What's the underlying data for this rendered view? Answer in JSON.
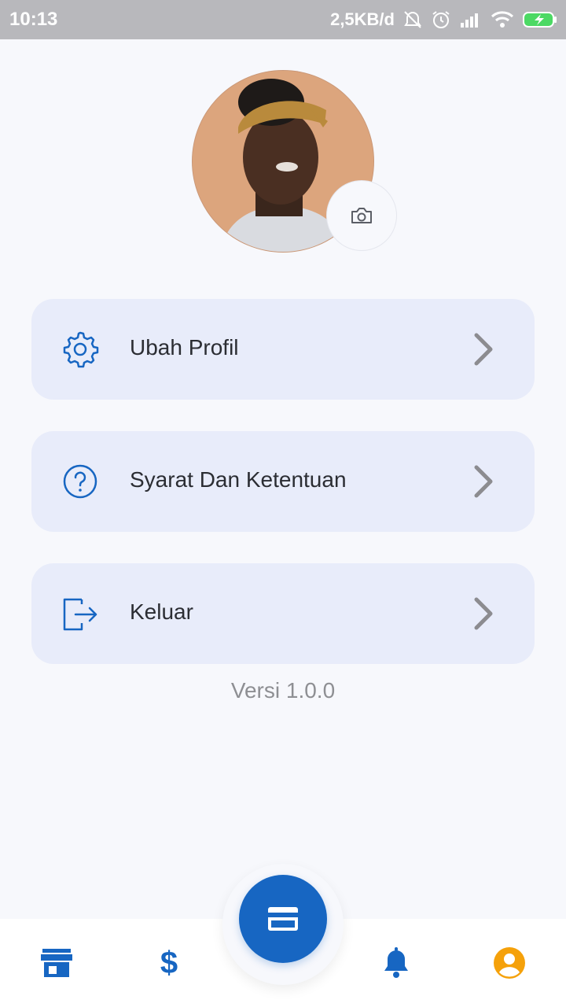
{
  "status_bar": {
    "time": "10:13",
    "network_speed": "2,5KB/d"
  },
  "profile": {
    "avatar_alt": "profile photo",
    "camera_icon": "camera-icon"
  },
  "menu": [
    {
      "label": "Ubah Profil",
      "icon": "gear-icon"
    },
    {
      "label": "Syarat Dan Ketentuan",
      "icon": "question-circle-icon"
    },
    {
      "label": "Keluar",
      "icon": "logout-icon"
    }
  ],
  "version": "Versi 1.0.0",
  "bottom_nav": {
    "items": [
      "store-icon",
      "dollar-icon",
      "card-icon",
      "bell-icon",
      "user-icon"
    ],
    "dollar_symbol": "$",
    "active": "user-icon"
  },
  "colors": {
    "primary": "#1766c2",
    "active_nav": "#f5a10a",
    "card_bg": "#e8ecfa",
    "page_bg": "#f7f8fc"
  }
}
